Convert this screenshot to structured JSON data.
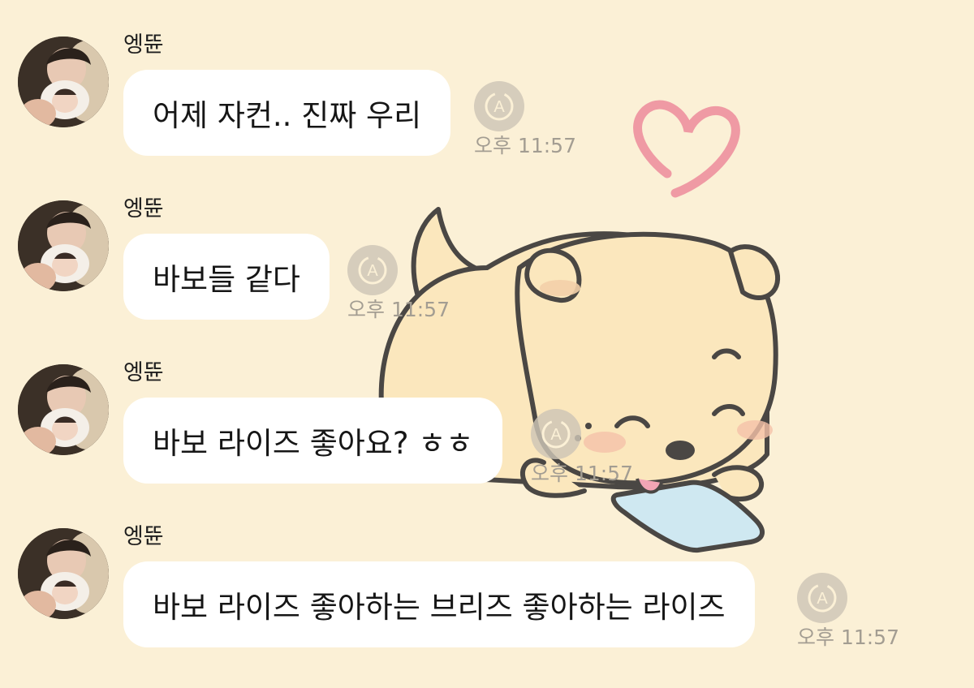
{
  "chat": {
    "messages": [
      {
        "sender": "엥뜐",
        "text": "어제 자컨.. 진짜 우리",
        "time": "오후 11:57"
      },
      {
        "sender": "엥뜐",
        "text": "바보들 같다",
        "time": "오후 11:57"
      },
      {
        "sender": "엥뜐",
        "text": "바보 라이즈 좋아요? ㅎㅎ",
        "time": "오후 11:57"
      },
      {
        "sender": "엥뜐",
        "text": "바보 라이즈 좋아하는 브리즈 좋아하는 라이즈",
        "time": "오후 11:57"
      }
    ]
  },
  "icons": {
    "translate": "translate-icon",
    "avatar": "avatar-photo",
    "wallpaper": "puppy-with-phone-and-heart"
  },
  "colors": {
    "background": "#fbf0d6",
    "bubble": "#ffffff",
    "time_text": "#a39d92",
    "heart": "#ef9aa4"
  }
}
